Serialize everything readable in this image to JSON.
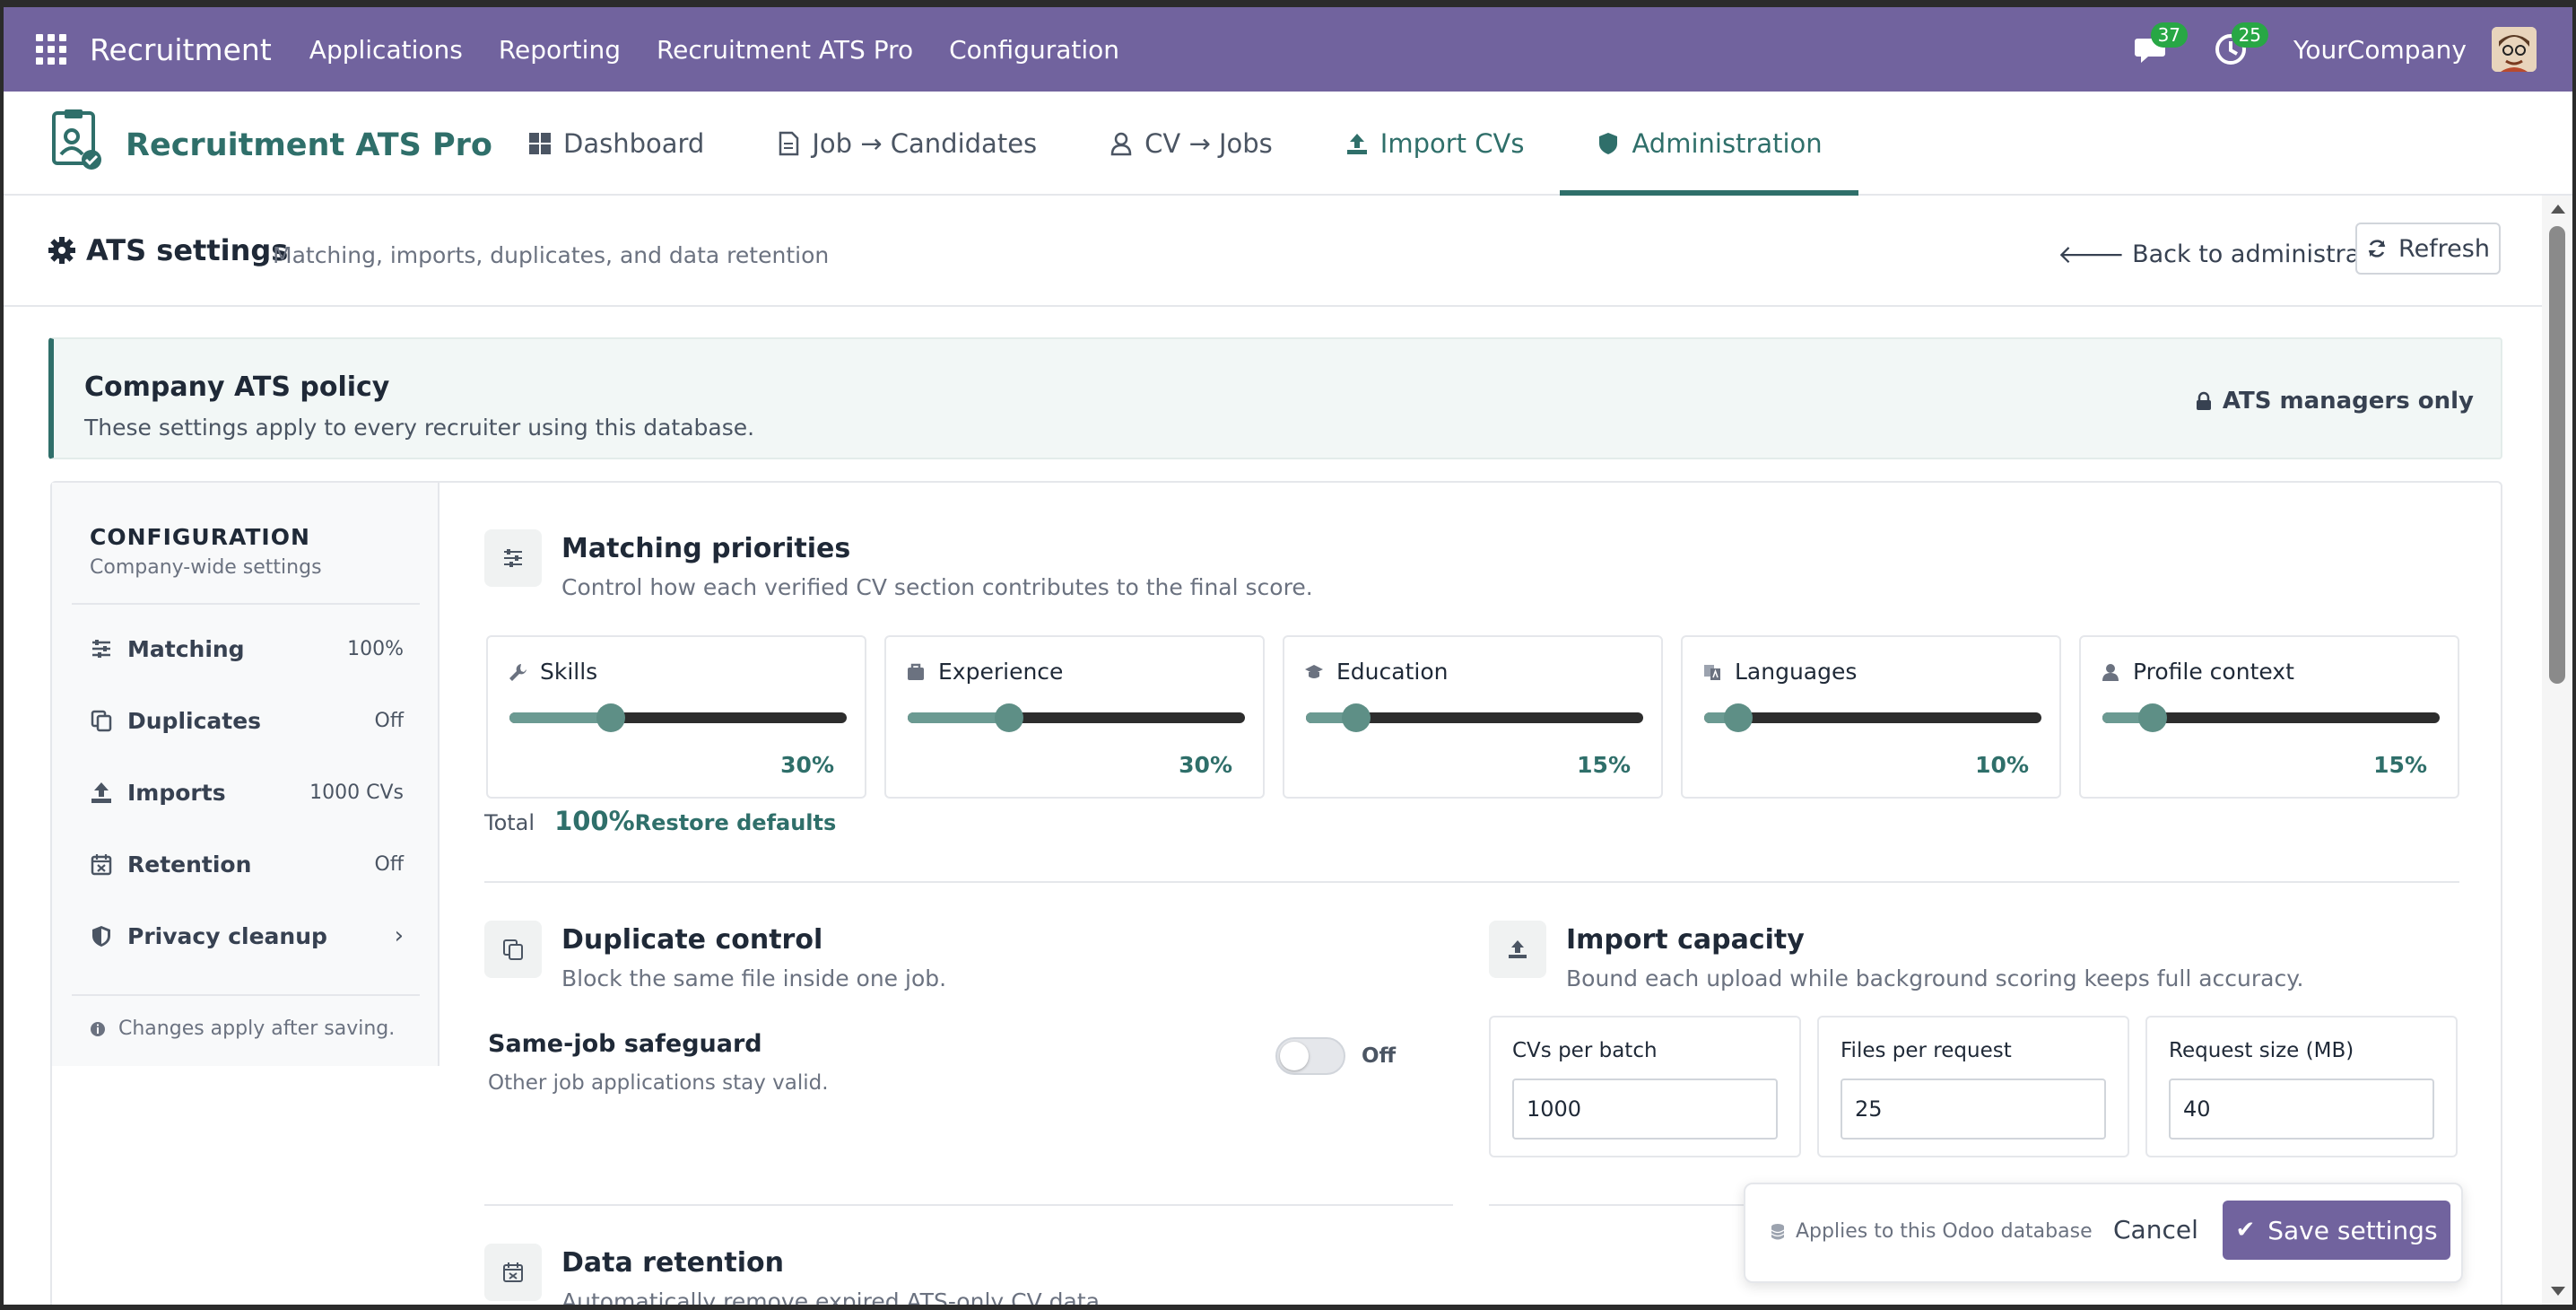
{
  "topbar": {
    "brand": "Recruitment",
    "menu": [
      "Applications",
      "Reporting",
      "Recruitment ATS Pro",
      "Configuration"
    ],
    "messages_count": "37",
    "activities_count": "25",
    "company": "YourCompany",
    "color": "#71639e"
  },
  "app": {
    "title": "Recruitment ATS Pro",
    "tabs": [
      {
        "label": "Dashboard",
        "icon": "dashboard-icon"
      },
      {
        "label": "Job → Candidates",
        "icon": "document-icon"
      },
      {
        "label": "CV → Jobs",
        "icon": "user-icon"
      },
      {
        "label": "Import CVs",
        "icon": "upload-icon"
      },
      {
        "label": "Administration",
        "icon": "shield-icon"
      }
    ],
    "active_tab": "Administration",
    "accent": "#2f6f6a"
  },
  "settings": {
    "title": "ATS settings",
    "subtitle": "Matching, imports, duplicates, and data retention",
    "back_label": "Back to administration",
    "refresh_label": "Refresh"
  },
  "policy": {
    "title": "Company ATS policy",
    "description": "These settings apply to every recruiter using this database.",
    "access": "ATS managers only"
  },
  "sidebar": {
    "title": "CONFIGURATION",
    "subtitle": "Company-wide settings",
    "items": [
      {
        "label": "Matching",
        "value": "100%",
        "icon": "sliders-icon"
      },
      {
        "label": "Duplicates",
        "value": "Off",
        "icon": "copy-icon"
      },
      {
        "label": "Imports",
        "value": "1000 CVs",
        "icon": "upload-icon"
      },
      {
        "label": "Retention",
        "value": "Off",
        "icon": "calendar-x-icon"
      },
      {
        "label": "Privacy cleanup",
        "value": "›",
        "icon": "shield-icon"
      }
    ],
    "note": "Changes apply after saving."
  },
  "matching": {
    "title": "Matching priorities",
    "subtitle": "Control how each verified CV section contributes to the final score.",
    "weights": [
      {
        "label": "Skills",
        "value": 30,
        "display": "30%",
        "icon": "wrench-icon"
      },
      {
        "label": "Experience",
        "value": 30,
        "display": "30%",
        "icon": "briefcase-icon"
      },
      {
        "label": "Education",
        "value": 15,
        "display": "15%",
        "icon": "graduation-cap-icon"
      },
      {
        "label": "Languages",
        "value": 10,
        "display": "10%",
        "icon": "language-icon"
      },
      {
        "label": "Profile context",
        "value": 15,
        "display": "15%",
        "icon": "user-icon"
      }
    ],
    "total_label": "Total",
    "total_value": "100%",
    "restore_label": "Restore defaults"
  },
  "duplicates": {
    "title": "Duplicate control",
    "subtitle": "Block the same file inside one job.",
    "safeguard_label": "Same-job safeguard",
    "safeguard_sub": "Other job applications stay valid.",
    "toggle_state": "Off"
  },
  "imports": {
    "title": "Import capacity",
    "subtitle": "Bound each upload while background scoring keeps full accuracy.",
    "fields": [
      {
        "label": "CVs per batch",
        "value": "1000"
      },
      {
        "label": "Files per request",
        "value": "25"
      },
      {
        "label": "Request size (MB)",
        "value": "40"
      }
    ]
  },
  "retention": {
    "title": "Data retention",
    "subtitle": "Automatically remove expired ATS-only CV data."
  },
  "actions": {
    "note": "Applies to this Odoo database",
    "cancel_label": "Cancel",
    "save_label": "Save settings"
  }
}
